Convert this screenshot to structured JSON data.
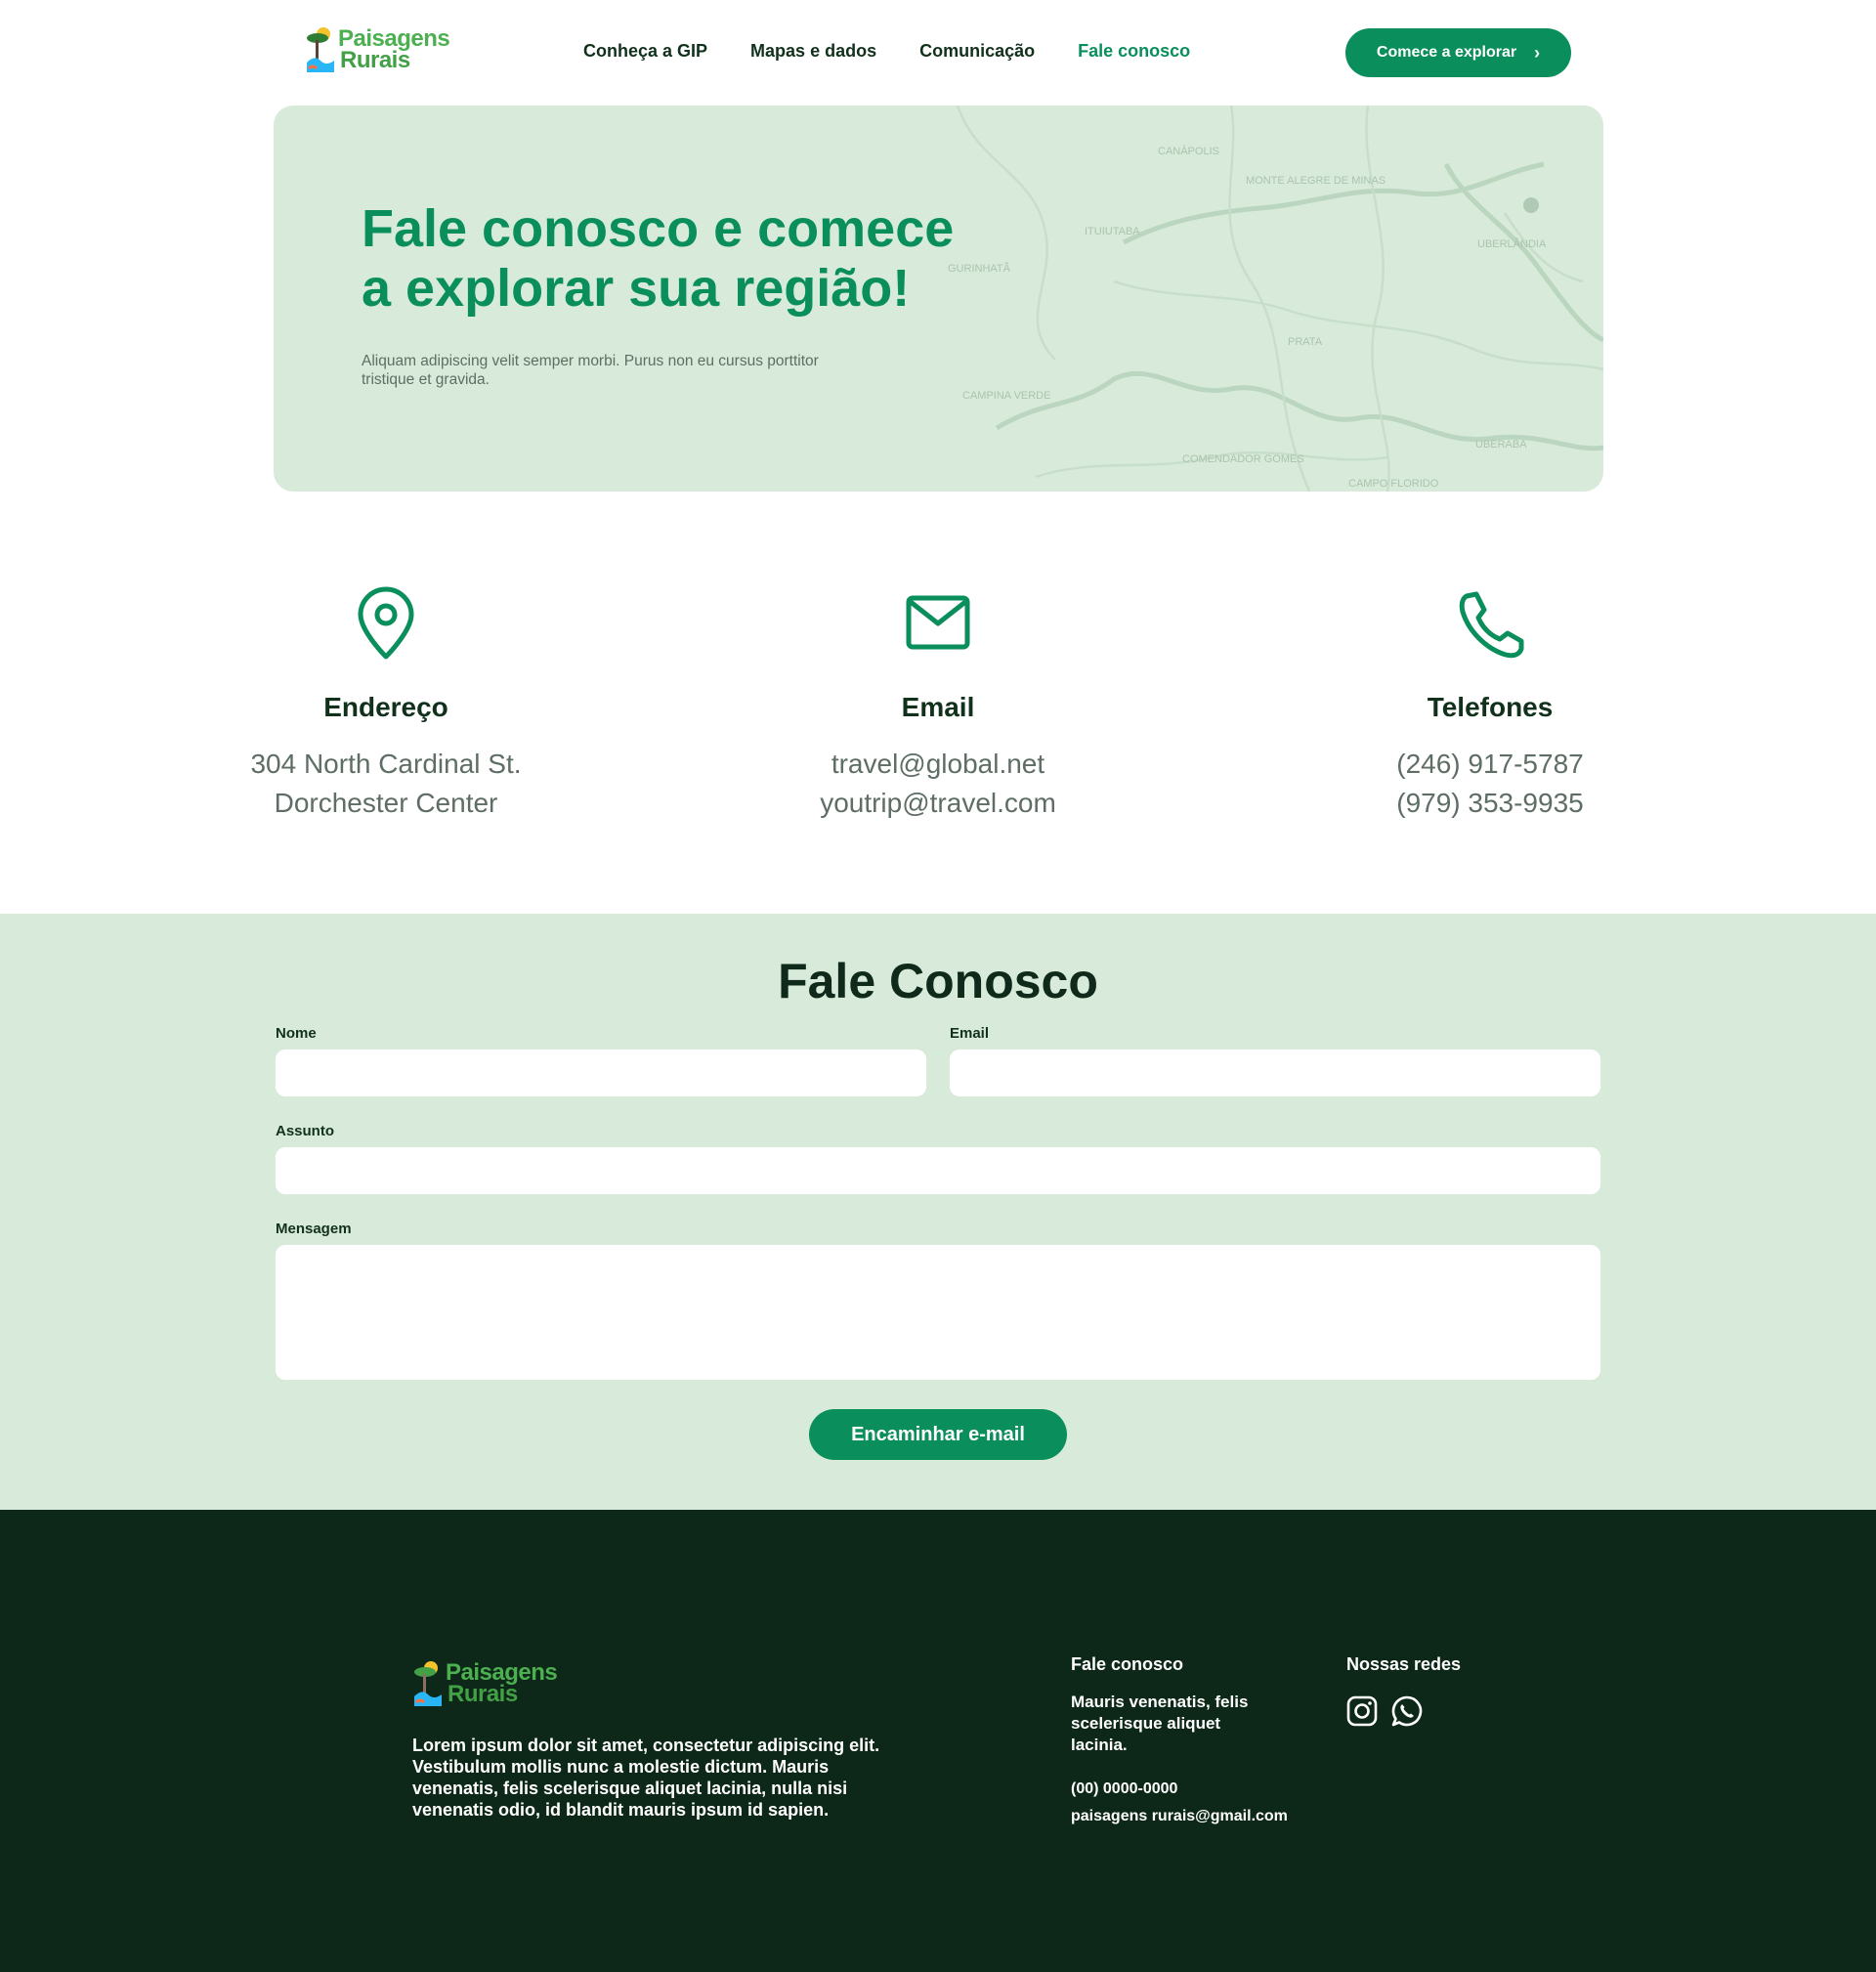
{
  "brand": {
    "logo_line1": "Paisagens",
    "logo_line2": "Rurais"
  },
  "nav": {
    "items": [
      {
        "label": "Conheça a GIP"
      },
      {
        "label": "Mapas e dados"
      },
      {
        "label": "Comunicação"
      },
      {
        "label": "Fale conosco"
      }
    ],
    "active_index": 3
  },
  "cta": {
    "label": "Comece a explorar"
  },
  "hero": {
    "title_line1": "Fale conosco e comece",
    "title_line2": "a explorar sua região!",
    "subtitle": "Aliquam adipiscing velit semper morbi. Purus non eu cursus porttitor tristique et gravida.",
    "map_labels": [
      "CANÁPOLIS",
      "MONTE ALEGRE DE MINAS",
      "ITUIUTABA",
      "GURINHATÃ",
      "UBERLÂNDIA",
      "PRATA",
      "CAMPINA VERDE",
      "COMENDADOR GOMES",
      "CAMPO FLORIDO",
      "UBERABA"
    ]
  },
  "info": [
    {
      "icon": "map-pin-icon",
      "title": "Endereço",
      "lines": [
        "304 North Cardinal St.",
        "Dorchester Center"
      ]
    },
    {
      "icon": "mail-icon",
      "title": "Email",
      "lines": [
        "travel@global.net",
        "youtrip@travel.com"
      ]
    },
    {
      "icon": "phone-icon",
      "title": "Telefones",
      "lines": [
        "(246) 917-5787",
        "(979) 353-9935"
      ]
    }
  ],
  "form": {
    "title": "Fale Conosco",
    "name_label": "Nome",
    "name_value": "",
    "email_label": "Email",
    "email_value": "",
    "subject_label": "Assunto",
    "subject_value": "",
    "message_label": "Mensagem",
    "message_value": "",
    "submit_label": "Encaminhar e-mail"
  },
  "footer": {
    "description": "Lorem ipsum dolor sit amet, consectetur adipiscing elit. Vestibulum mollis nunc a molestie dictum. Mauris venenatis, felis scelerisque aliquet lacinia, nulla nisi venenatis odio, id blandit mauris ipsum id sapien.",
    "contact_title": "Fale conosco",
    "contact_text": "Mauris venenatis, felis scelerisque aliquet lacinia.",
    "phone": "(00) 0000-0000",
    "email": "paisagens rurais@gmail.com",
    "social_title": "Nossas redes",
    "socials": [
      "instagram-icon",
      "whatsapp-icon"
    ]
  },
  "colors": {
    "primary": "#0a8f5c",
    "light_green": "#d8ebda",
    "dark_footer": "#0d2818",
    "text_dark": "#12311c",
    "text_muted": "#5e6e64"
  }
}
